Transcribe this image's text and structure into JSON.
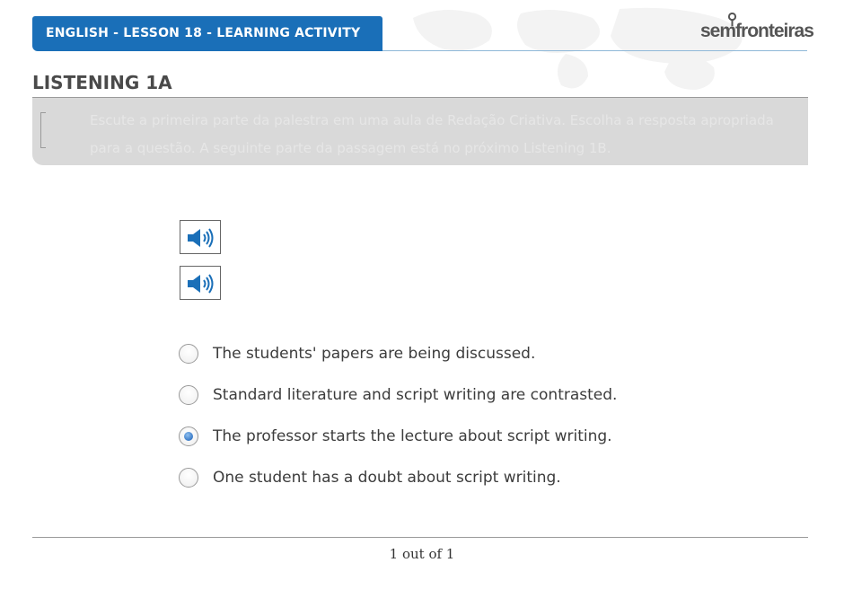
{
  "header": {
    "lesson_title": "ENGLISH - LESSON 18 - LEARNING ACTIVITY",
    "brand_color": "#1a6fb8",
    "logo_text": "semfronteiras"
  },
  "activity": {
    "title": "LISTENING 1A",
    "instructions": "Escute a primeira parte da palestra em uma aula de Redação Criativa. Escolha a resposta apropriada para a questão. A seguinte parte da passagem está no próximo Listening 1B."
  },
  "audio_buttons": [
    {
      "icon": "speaker-icon"
    },
    {
      "icon": "speaker-icon"
    }
  ],
  "options": [
    {
      "label": "The students' papers are being discussed.",
      "selected": false
    },
    {
      "label": "Standard literature and script writing are contrasted.",
      "selected": false
    },
    {
      "label": "The professor starts the lecture about script writing.",
      "selected": true
    },
    {
      "label": "One student has a doubt about script writing.",
      "selected": false
    }
  ],
  "pagination": {
    "label": "1 out of 1"
  }
}
